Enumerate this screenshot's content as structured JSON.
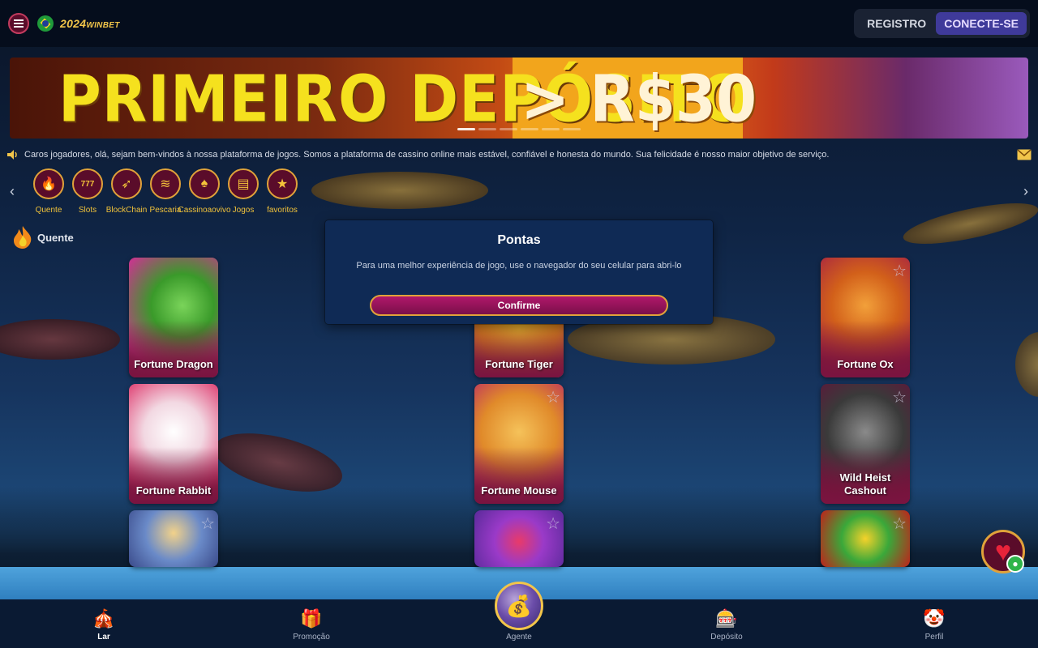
{
  "header": {
    "logo_text": "2024",
    "logo_suffix": "WINBET",
    "register_label": "REGISTRO",
    "login_label": "CONECTE-SE"
  },
  "banner": {
    "headline": "PRIMEIRO DEPÓSITO",
    "amount": "> R$30"
  },
  "marquee": {
    "text": "Caros jogadores, olá, sejam bem-vindos à nossa plataforma de jogos. Somos a plataforma de cassino online mais estável, confiável e honesta do mundo. Sua felicidade é nosso maior objetivo de serviço."
  },
  "categories": [
    {
      "label": "Quente",
      "icon": "flame-icon"
    },
    {
      "label": "Slots",
      "icon": "slots-icon"
    },
    {
      "label": "BlockChain",
      "icon": "rocket-icon"
    },
    {
      "label": "Pescaria",
      "icon": "fish-icon"
    },
    {
      "label": "Cassinoaovivo",
      "icon": "spade-icon"
    },
    {
      "label": "Jogos",
      "icon": "ticket-icon"
    },
    {
      "label": "favoritos",
      "icon": "star-icon"
    }
  ],
  "section": {
    "title": "Quente"
  },
  "games": [
    {
      "name": "Fortune Dragon"
    },
    {
      "name": "Fortune Tiger"
    },
    {
      "name": "Fortune Ox"
    },
    {
      "name": "Fortune Rabbit"
    },
    {
      "name": "Fortune Mouse"
    },
    {
      "name": "Wild Heist Cashout"
    },
    {
      "name": ""
    },
    {
      "name": ""
    },
    {
      "name": ""
    }
  ],
  "modal": {
    "title": "Pontas",
    "message": "Para uma melhor experiência de jogo, use o navegador do seu celular para abri-lo",
    "confirm_label": "Confirme"
  },
  "bottom_nav": [
    {
      "label": "Lar",
      "icon": "circus-icon",
      "active": true
    },
    {
      "label": "Promoção",
      "icon": "gift-icon",
      "active": false
    },
    {
      "label": "Agente",
      "icon": "agent-icon",
      "active": false
    },
    {
      "label": "Depósito",
      "icon": "slot-machine-icon",
      "active": false
    },
    {
      "label": "Perfil",
      "icon": "profile-icon",
      "active": false
    }
  ],
  "colors": {
    "accent_gold": "#e0a23a",
    "accent_magenta": "#b0186a",
    "login_purple": "#3f3a9a",
    "modal_bg": "#0f2a55"
  }
}
